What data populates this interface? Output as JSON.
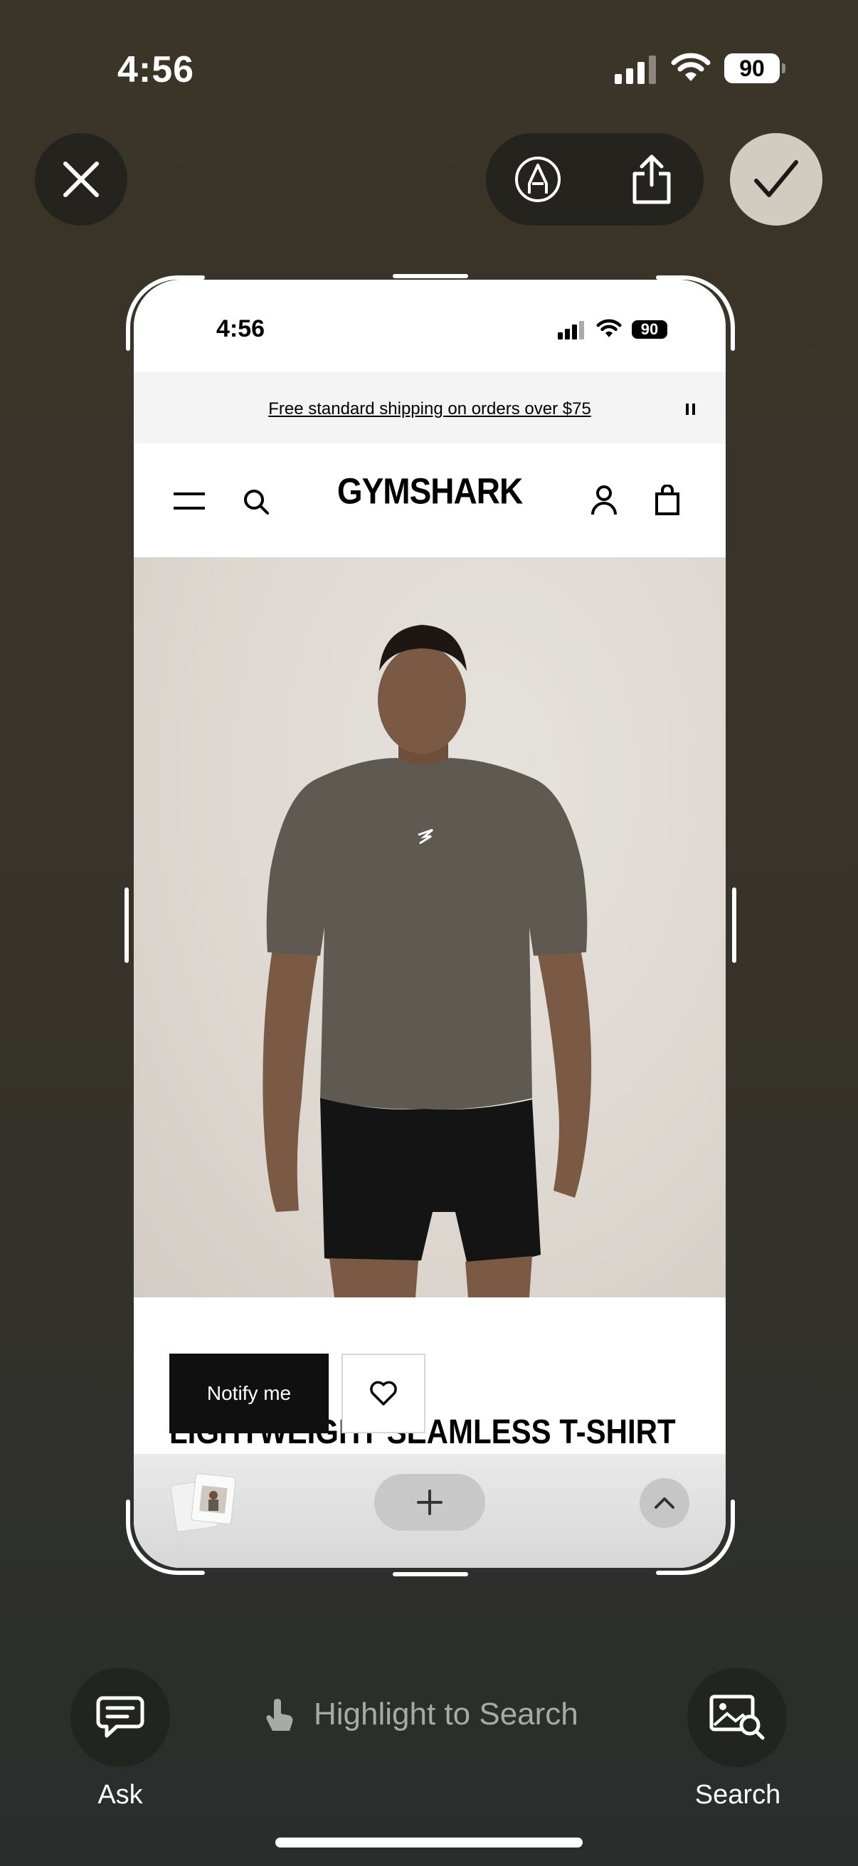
{
  "status_bar": {
    "time": "4:56",
    "battery": "90"
  },
  "toolbar_top": {
    "close_icon": "x-mark-icon",
    "markup_icon": "pen-markup-icon",
    "share_icon": "share-icon",
    "confirm_icon": "checkmark-icon"
  },
  "screenshot": {
    "status_bar": {
      "time": "4:56",
      "battery": "90"
    },
    "banner": {
      "text": "Free standard shipping on orders over $75"
    },
    "header": {
      "logo": "GYMSHARK"
    },
    "product": {
      "title": "LIGHTWEIGHT SEAMLESS T-SHIRT",
      "notify_label": "Notify me"
    }
  },
  "bottom_bar": {
    "ask_label": "Ask",
    "highlight_label": "Highlight to Search",
    "search_label": "Search"
  },
  "colors": {
    "background": "#3b3528",
    "button_dark": "#25231d",
    "confirm": "#d2ccc0"
  }
}
